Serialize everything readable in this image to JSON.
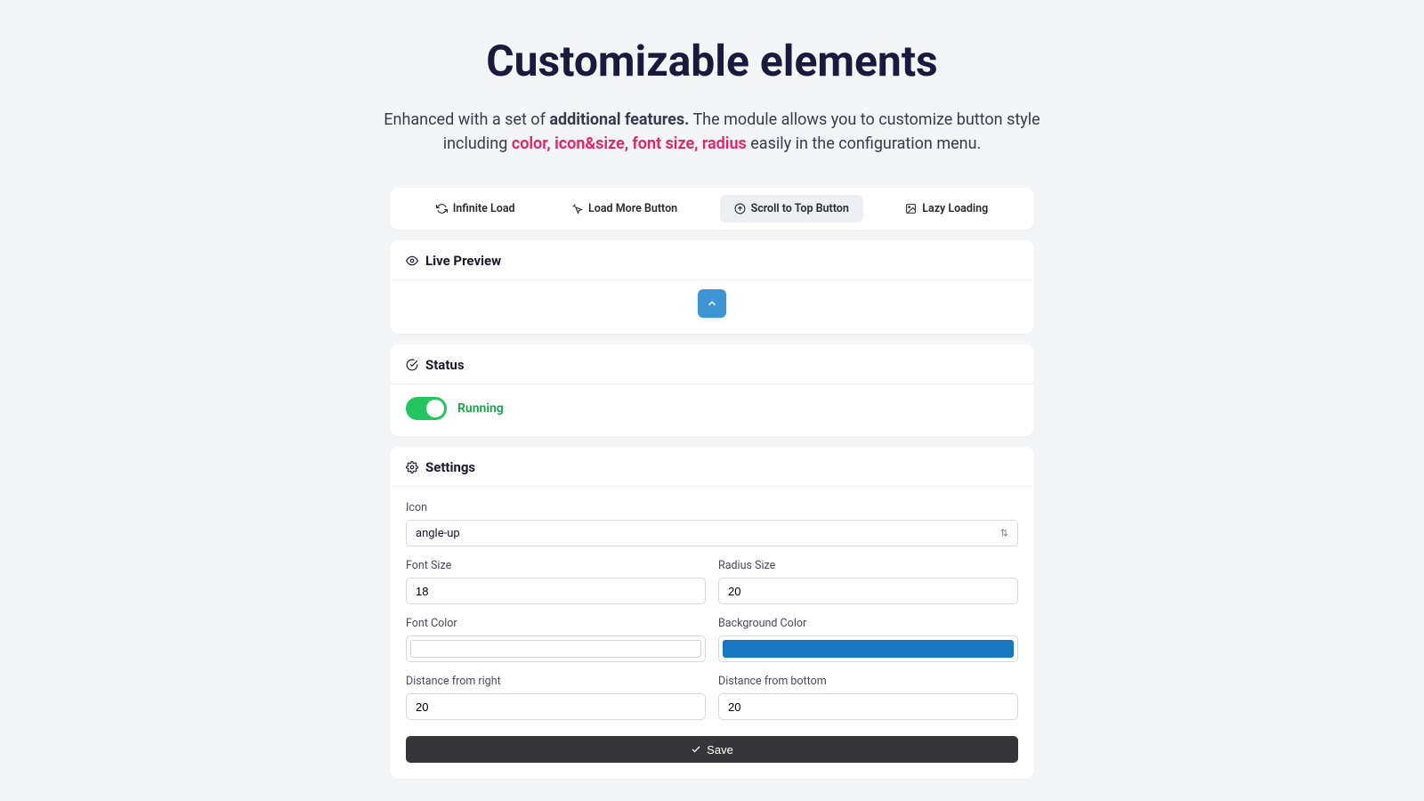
{
  "hero": {
    "title": "Customizable elements",
    "desc_pre": "Enhanced with a set of ",
    "desc_bold": "additional features.",
    "desc_mid": " The module allows you to customize button style including ",
    "desc_highlight": "color, icon&size, font size, radius",
    "desc_post": " easily in the configuration menu."
  },
  "tabs": {
    "infinite": "Infinite Load",
    "loadmore": "Load More Button",
    "scrolltop": "Scroll to Top Button",
    "lazy": "Lazy Loading"
  },
  "preview": {
    "header": "Live Preview"
  },
  "status": {
    "header": "Status",
    "label": "Running"
  },
  "settings": {
    "header": "Settings",
    "icon_label": "Icon",
    "icon_value": "angle-up",
    "fontsize_label": "Font Size",
    "fontsize_value": "18",
    "radius_label": "Radius Size",
    "radius_value": "20",
    "fontcolor_label": "Font Color",
    "fontcolor_value": "#ffffff",
    "bgcolor_label": "Background Color",
    "bgcolor_value": "#1678c2",
    "dright_label": "Distance from right",
    "dright_value": "20",
    "dbottom_label": "Distance from bottom",
    "dbottom_value": "20",
    "save_label": "Save"
  }
}
